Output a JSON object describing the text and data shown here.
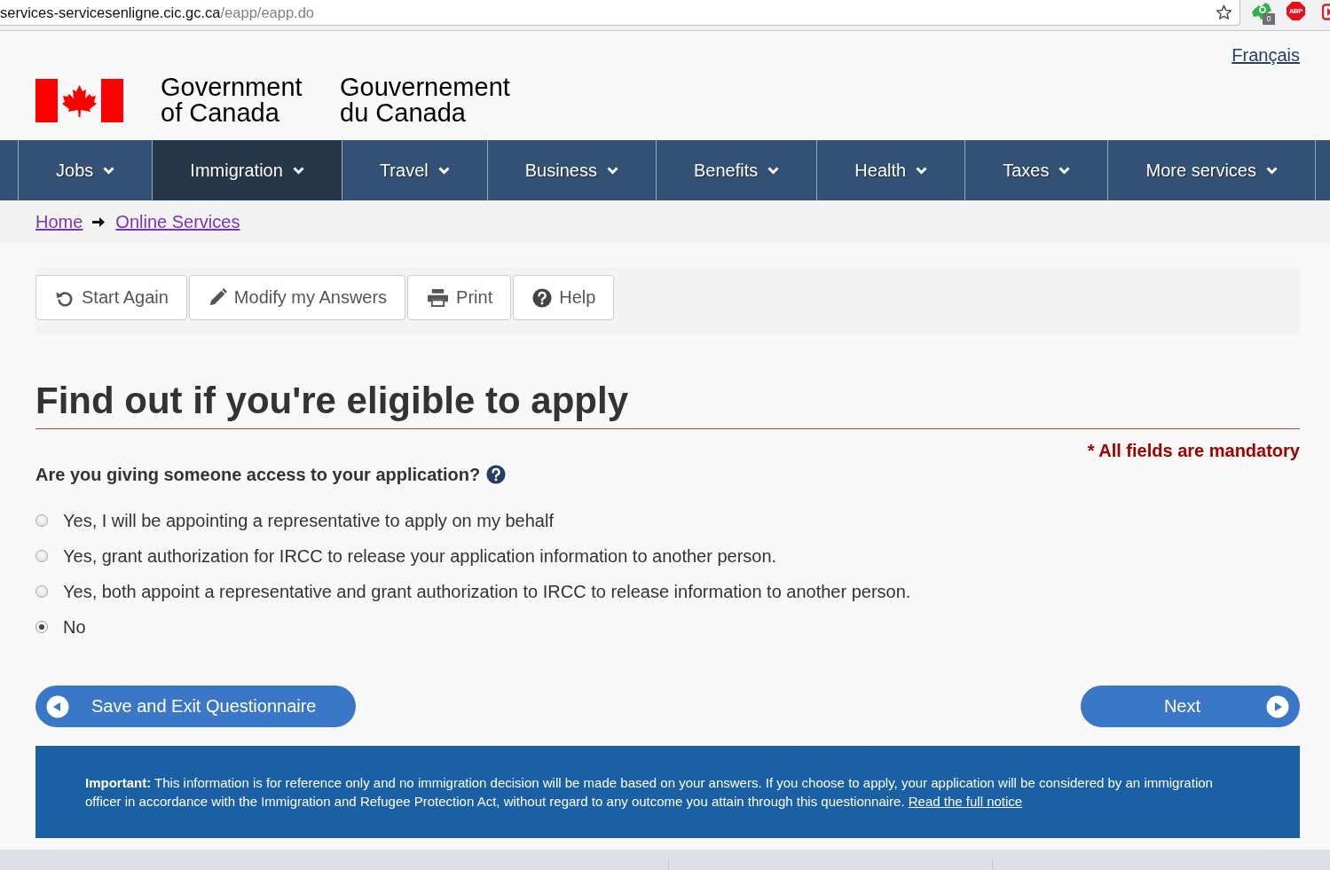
{
  "browser": {
    "url_host": "services-servicesenligne.cic.gc.ca",
    "url_path": "/eapp/eapp.do",
    "extension_count": "0",
    "extension_label": "ABP"
  },
  "header": {
    "language_link": "Français",
    "signature_en": "Government of Canada",
    "signature_fr": "Gouvernement du Canada"
  },
  "nav": {
    "items": [
      {
        "label": "Jobs",
        "selected": false
      },
      {
        "label": "Immigration",
        "selected": true
      },
      {
        "label": "Travel",
        "selected": false
      },
      {
        "label": "Business",
        "selected": false
      },
      {
        "label": "Benefits",
        "selected": false
      },
      {
        "label": "Health",
        "selected": false
      },
      {
        "label": "Taxes",
        "selected": false
      },
      {
        "label": "More services",
        "selected": false
      }
    ]
  },
  "breadcrumb": [
    "Home",
    "Online Services"
  ],
  "toolbar": {
    "buttons": [
      {
        "label": "Start Again",
        "kind": "restart"
      },
      {
        "label": "Modify my Answers",
        "kind": "edit"
      },
      {
        "label": "Print",
        "kind": "print"
      },
      {
        "label": "Help",
        "kind": "help"
      }
    ]
  },
  "page": {
    "title": "Find out if you're eligible to apply",
    "mandatory_note": "* All fields are mandatory"
  },
  "question": {
    "text": "Are you giving someone access to your application?",
    "options": [
      {
        "label": "Yes, I will be appointing a representative to apply on my behalf",
        "selected": false
      },
      {
        "label": "Yes, grant authorization for IRCC to release your application information to another person.",
        "selected": false
      },
      {
        "label": "Yes, both appoint a representative and grant authorization to IRCC to release information to another person.",
        "selected": false
      },
      {
        "label": "No",
        "selected": true
      }
    ]
  },
  "actions": {
    "back": "Save and Exit Questionnaire",
    "next": "Next"
  },
  "notice": {
    "text": "**Important:** This information is for reference only and no immigration decision will be made based on your answers. If you choose to apply, your application will be considered by an immigration officer in accordance with the Immigration and Refugee Protection Act, without regard to any outcome you attain through this questionnaire.",
    "link": "Read the full notice"
  }
}
